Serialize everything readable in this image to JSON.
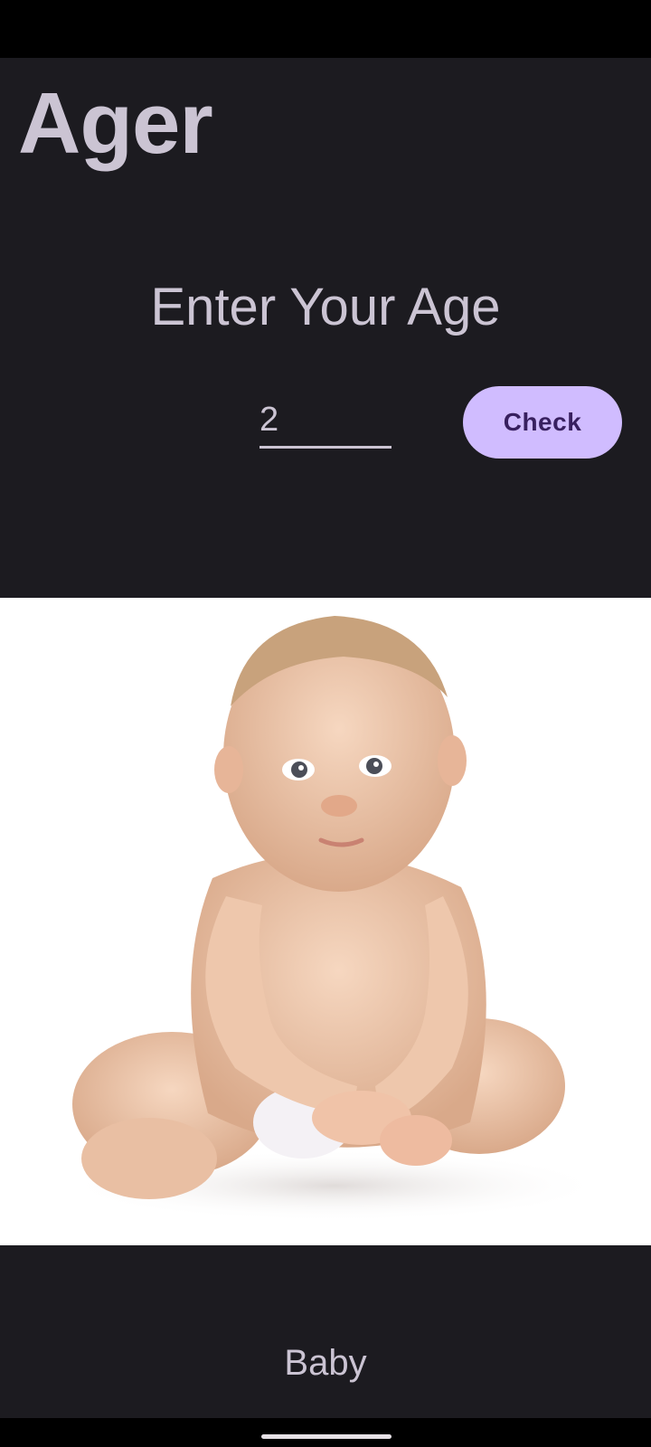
{
  "app": {
    "title": "Ager"
  },
  "form": {
    "prompt": "Enter Your Age",
    "age_value": "2",
    "check_label": "Check"
  },
  "result": {
    "image_subject": "baby-photo",
    "label": "Baby"
  },
  "colors": {
    "background": "#1c1b20",
    "text": "#cbc4d3",
    "button_bg": "#d0bcff",
    "button_text": "#38205f"
  }
}
